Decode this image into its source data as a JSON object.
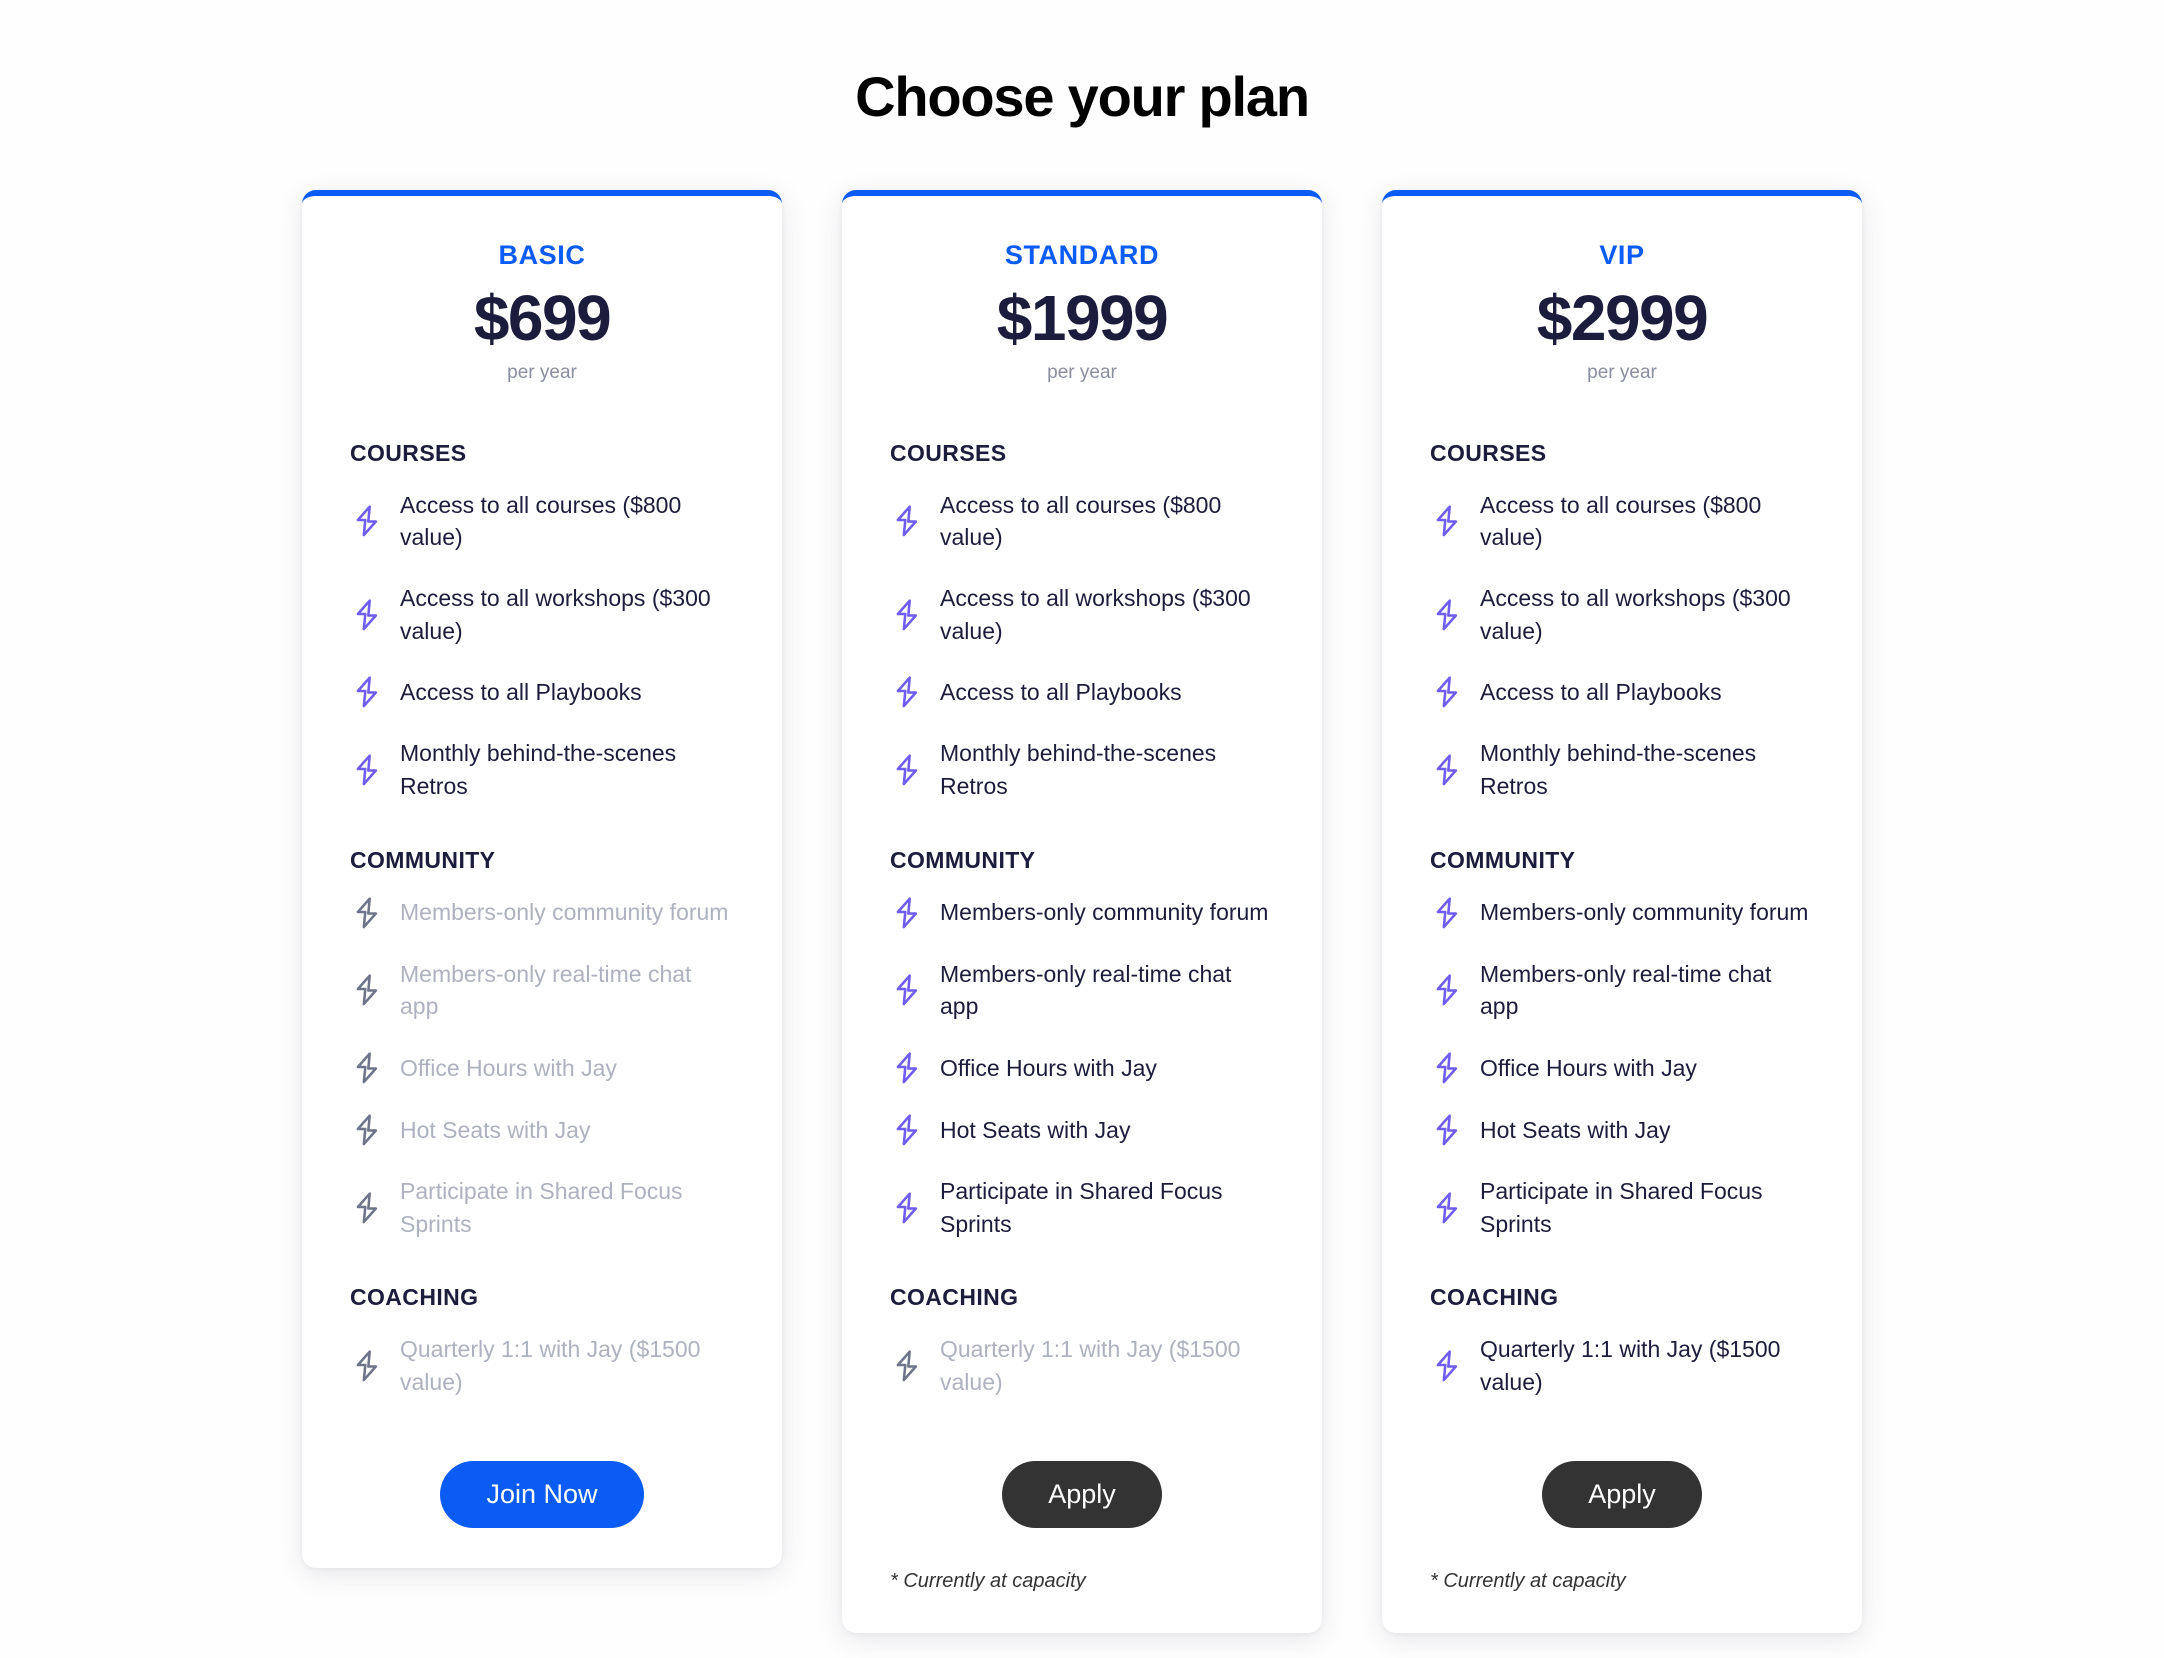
{
  "header": {
    "title": "Choose your plan"
  },
  "colors": {
    "accent_blue": "#0b5cf5",
    "price_navy": "#1c1c3c",
    "icon_active_purple": "#6f5cf0",
    "icon_disabled_gray": "#6e7489",
    "text_disabled": "#adb2be",
    "button_dark": "#333333",
    "period_gray": "#8a8fa0"
  },
  "icons": {
    "feature_bullet": "bolt-icon"
  },
  "plans": [
    {
      "id": "basic",
      "name": "BASIC",
      "price": "$699",
      "period": "per year",
      "cta_label": "Join Now",
      "cta_style": "primary",
      "footnote": "",
      "sections": [
        {
          "title": "COURSES",
          "features": [
            {
              "text": "Access to all courses ($800 value)",
              "enabled": true
            },
            {
              "text": "Access to all workshops ($300 value)",
              "enabled": true
            },
            {
              "text": "Access to all Playbooks",
              "enabled": true
            },
            {
              "text": "Monthly behind-the-scenes Retros",
              "enabled": true
            }
          ]
        },
        {
          "title": "COMMUNITY",
          "features": [
            {
              "text": "Members-only community forum",
              "enabled": false
            },
            {
              "text": "Members-only real-time chat app",
              "enabled": false
            },
            {
              "text": "Office Hours with Jay",
              "enabled": false
            },
            {
              "text": "Hot Seats with Jay",
              "enabled": false
            },
            {
              "text": "Participate in Shared Focus Sprints",
              "enabled": false
            }
          ]
        },
        {
          "title": "COACHING",
          "features": [
            {
              "text": "Quarterly 1:1 with Jay ($1500 value)",
              "enabled": false
            }
          ]
        }
      ]
    },
    {
      "id": "standard",
      "name": "STANDARD",
      "price": "$1999",
      "period": "per year",
      "cta_label": "Apply",
      "cta_style": "dark",
      "footnote": "* Currently at capacity",
      "sections": [
        {
          "title": "COURSES",
          "features": [
            {
              "text": "Access to all courses ($800 value)",
              "enabled": true
            },
            {
              "text": "Access to all workshops ($300 value)",
              "enabled": true
            },
            {
              "text": "Access to all Playbooks",
              "enabled": true
            },
            {
              "text": "Monthly behind-the-scenes Retros",
              "enabled": true
            }
          ]
        },
        {
          "title": "COMMUNITY",
          "features": [
            {
              "text": "Members-only community forum",
              "enabled": true
            },
            {
              "text": "Members-only real-time chat app",
              "enabled": true
            },
            {
              "text": "Office Hours with Jay",
              "enabled": true
            },
            {
              "text": "Hot Seats with Jay",
              "enabled": true
            },
            {
              "text": "Participate in Shared Focus Sprints",
              "enabled": true
            }
          ]
        },
        {
          "title": "COACHING",
          "features": [
            {
              "text": "Quarterly 1:1 with Jay ($1500 value)",
              "enabled": false
            }
          ]
        }
      ]
    },
    {
      "id": "vip",
      "name": "VIP",
      "price": "$2999",
      "period": "per year",
      "cta_label": "Apply",
      "cta_style": "dark",
      "footnote": "* Currently at capacity",
      "sections": [
        {
          "title": "COURSES",
          "features": [
            {
              "text": "Access to all courses ($800 value)",
              "enabled": true
            },
            {
              "text": "Access to all workshops ($300 value)",
              "enabled": true
            },
            {
              "text": "Access to all Playbooks",
              "enabled": true
            },
            {
              "text": "Monthly behind-the-scenes Retros",
              "enabled": true
            }
          ]
        },
        {
          "title": "COMMUNITY",
          "features": [
            {
              "text": "Members-only community forum",
              "enabled": true
            },
            {
              "text": "Members-only real-time chat app",
              "enabled": true
            },
            {
              "text": "Office Hours with Jay",
              "enabled": true
            },
            {
              "text": "Hot Seats with Jay",
              "enabled": true
            },
            {
              "text": "Participate in Shared Focus Sprints",
              "enabled": true
            }
          ]
        },
        {
          "title": "COACHING",
          "features": [
            {
              "text": "Quarterly 1:1 with Jay ($1500 value)",
              "enabled": true
            }
          ]
        }
      ]
    }
  ]
}
